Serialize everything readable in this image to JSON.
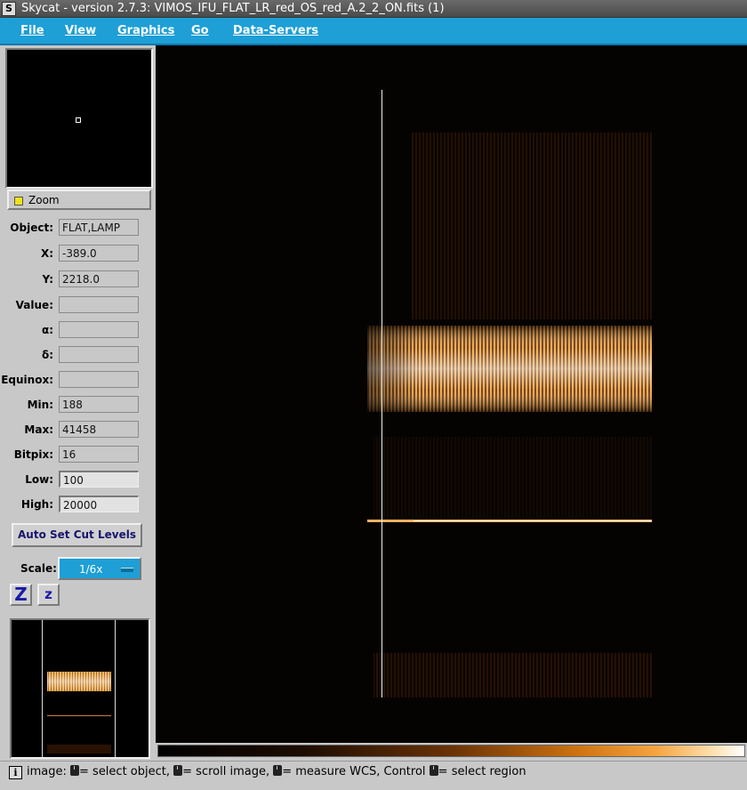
{
  "window": {
    "title": "Skycat - version 2.7.3: VIMOS_IFU_FLAT_LR_red_OS_red_A.2_2_ON.fits (1)"
  },
  "menubar": {
    "items": [
      "File",
      "View",
      "Graphics",
      "Go",
      "Data-Servers"
    ]
  },
  "panel": {
    "zoom_label": "Zoom",
    "info": {
      "object": {
        "label": "Object:",
        "value": "FLAT,LAMP"
      },
      "x": {
        "label": "X:",
        "value": "-389.0"
      },
      "y": {
        "label": "Y:",
        "value": "2218.0"
      },
      "value": {
        "label": "Value:",
        "value": ""
      },
      "alpha": {
        "label": "α:",
        "value": ""
      },
      "delta": {
        "label": "δ:",
        "value": ""
      },
      "equinox": {
        "label": "Equinox:",
        "value": ""
      },
      "min": {
        "label": "Min:",
        "value": "188"
      },
      "max": {
        "label": "Max:",
        "value": "41458"
      },
      "bitpix": {
        "label": "Bitpix:",
        "value": "16"
      },
      "low": {
        "label": "Low:",
        "value": "100"
      },
      "high": {
        "label": "High:",
        "value": "20000"
      }
    },
    "auto_cut_label": "Auto Set Cut Levels",
    "scale": {
      "label": "Scale:",
      "value": "1/6x"
    },
    "zoom_in_label": "Z",
    "zoom_out_label": "z"
  },
  "colors": {
    "menubar_bg": "#1e9fd6",
    "colormap_mid": "#cf7412",
    "image_bg": "#050302"
  },
  "status": {
    "prefix": "image:",
    "part1": "= select object,",
    "part2": "= scroll image,",
    "part3": "= measure WCS, Control",
    "part4": "= select region"
  }
}
